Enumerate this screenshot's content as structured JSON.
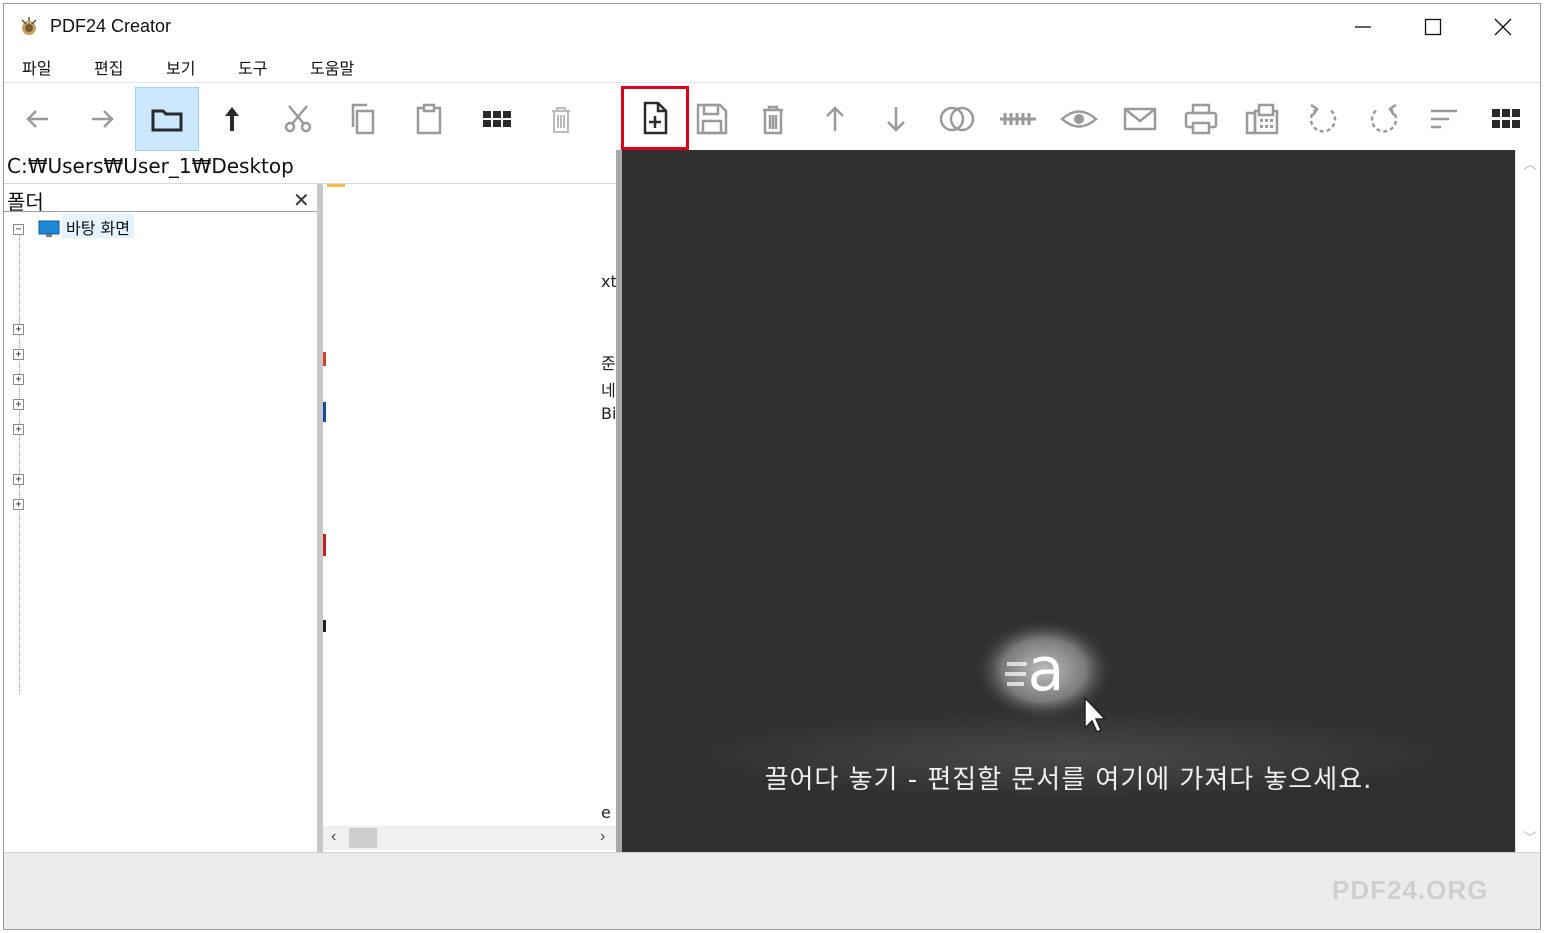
{
  "window": {
    "title": "PDF24 Creator",
    "controls": {
      "minimize": "minimize-icon",
      "maximize": "maximize-icon",
      "close": "close-icon"
    }
  },
  "menu": [
    {
      "label": "파일"
    },
    {
      "label": "편집"
    },
    {
      "label": "보기"
    },
    {
      "label": "도구"
    },
    {
      "label": "도움말"
    }
  ],
  "toolbar": {
    "items": [
      {
        "icon": "back-arrow-icon"
      },
      {
        "icon": "forward-arrow-icon"
      },
      {
        "icon": "folder-icon",
        "active": true
      },
      {
        "icon": "up-folder-icon"
      },
      {
        "icon": "cut-icon"
      },
      {
        "icon": "copy-icon"
      },
      {
        "icon": "paste-icon"
      },
      {
        "icon": "grid-view-icon"
      },
      {
        "icon": "delete-icon"
      },
      {
        "icon": "new-document-icon",
        "highlighted": true
      },
      {
        "icon": "save-icon"
      },
      {
        "icon": "trash-icon"
      },
      {
        "icon": "move-up-icon"
      },
      {
        "icon": "move-down-icon"
      },
      {
        "icon": "merge-icon"
      },
      {
        "icon": "split-icon"
      },
      {
        "icon": "preview-icon"
      },
      {
        "icon": "email-icon"
      },
      {
        "icon": "print-icon"
      },
      {
        "icon": "fax-icon"
      },
      {
        "icon": "rotate-left-icon"
      },
      {
        "icon": "rotate-right-icon"
      },
      {
        "icon": "list-view-icon"
      },
      {
        "icon": "tile-view-icon"
      }
    ],
    "highlight_color": "#e0001b"
  },
  "left_panel": {
    "path": "C:₩Users₩User_1₩Desktop",
    "folder_title": "폴더",
    "tree_root": "바탕 화면",
    "file_fragments": [
      "xt",
      "준",
      "네",
      "Bit",
      "e"
    ]
  },
  "drop_area": {
    "text": "끌어다 놓기 - 편집할 문서를 여기에 가져다 놓으세요.",
    "background": "#303030"
  },
  "status": {
    "brand": "PDF24.ORG"
  }
}
